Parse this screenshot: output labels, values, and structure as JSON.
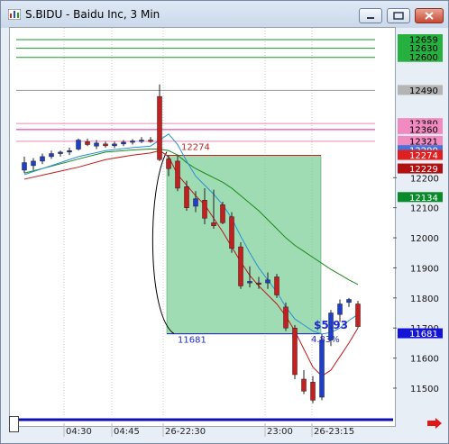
{
  "window": {
    "title": "S.BIDU - Baidu Inc, 3 Min",
    "colors": {
      "title_bg": "#d6e2f0",
      "close": "#c8503a"
    }
  },
  "controls": {
    "minimize_icon": "minimize-icon",
    "maximize_icon": "maximize-icon",
    "close_icon": "close-icon"
  },
  "chart_data": {
    "type": "candlestick",
    "title": "",
    "ylim": [
      11420,
      12710
    ],
    "y_ticks": [
      {
        "value": 11500,
        "label": "11500"
      },
      {
        "value": 11600,
        "label": "11600"
      },
      {
        "value": 11700,
        "label": "11700"
      },
      {
        "value": 11800,
        "label": "11800"
      },
      {
        "value": 11900,
        "label": "11900"
      },
      {
        "value": 12000,
        "label": "12000"
      },
      {
        "value": 12100,
        "label": "12100"
      },
      {
        "value": 12200,
        "label": "12200"
      }
    ],
    "x_labels": [
      "04:30",
      "04:45",
      "26-22:30",
      "23:00",
      "26-23:15"
    ],
    "price_tags": [
      {
        "value": 12659,
        "label": "12659",
        "bg": "#26b040",
        "fg": "#000000"
      },
      {
        "value": 12630,
        "label": "12630",
        "bg": "#26b040",
        "fg": "#000000"
      },
      {
        "value": 12600,
        "label": "12600",
        "bg": "#26b040",
        "fg": "#000000"
      },
      {
        "value": 12490,
        "label": "12490",
        "bg": "#b4b4b4",
        "fg": "#000000"
      },
      {
        "value": 12380,
        "label": "12380",
        "bg": "#f08ac0",
        "fg": "#000000"
      },
      {
        "value": 12360,
        "label": "12360",
        "bg": "#f08ac0",
        "fg": "#000000"
      },
      {
        "value": 12321,
        "label": "12321",
        "bg": "#f08ac0",
        "fg": "#000000"
      },
      {
        "value": 12290,
        "label": "12290",
        "bg": "#4a72d8",
        "fg": "#ffffff"
      },
      {
        "value": 12274,
        "label": "12274",
        "bg": "#e02020",
        "fg": "#ffffff"
      },
      {
        "value": 12229,
        "label": "12229",
        "bg": "#b01010",
        "fg": "#ffffff"
      },
      {
        "value": 12134,
        "label": "12134",
        "bg": "#0a8a2a",
        "fg": "#ffffff"
      },
      {
        "value": 11681,
        "label": "11681",
        "bg": "#1414d8",
        "fg": "#ffffff"
      }
    ],
    "levels": [
      {
        "value": 12659,
        "color": "#1a9a2a"
      },
      {
        "value": 12630,
        "color": "#1a9a2a"
      },
      {
        "value": 12600,
        "color": "#1a9a2a"
      },
      {
        "value": 12490,
        "color": "#9a9a9a"
      },
      {
        "value": 12380,
        "color": "#e98ab8"
      },
      {
        "value": 12360,
        "color": "#e020a0"
      },
      {
        "value": 12321,
        "color": "#e98ab8"
      }
    ],
    "candles": [
      {
        "o": 12250,
        "h": 12270,
        "l": 12215,
        "c": 12225,
        "bull": true
      },
      {
        "o": 12240,
        "h": 12265,
        "l": 12225,
        "c": 12255,
        "bull": true
      },
      {
        "o": 12255,
        "h": 12280,
        "l": 12245,
        "c": 12270,
        "bull": true
      },
      {
        "o": 12270,
        "h": 12290,
        "l": 12262,
        "c": 12280,
        "bull": true
      },
      {
        "o": 12280,
        "h": 12290,
        "l": 12270,
        "c": 12285,
        "bull": true
      },
      {
        "o": 12285,
        "h": 12300,
        "l": 12275,
        "c": 12290,
        "bull": true
      },
      {
        "o": 12295,
        "h": 12330,
        "l": 12290,
        "c": 12325,
        "bull": true
      },
      {
        "o": 12320,
        "h": 12330,
        "l": 12305,
        "c": 12310,
        "bull": false
      },
      {
        "o": 12305,
        "h": 12325,
        "l": 12295,
        "c": 12315,
        "bull": true
      },
      {
        "o": 12312,
        "h": 12320,
        "l": 12300,
        "c": 12306,
        "bull": false
      },
      {
        "o": 12306,
        "h": 12320,
        "l": 12298,
        "c": 12312,
        "bull": true
      },
      {
        "o": 12312,
        "h": 12325,
        "l": 12305,
        "c": 12318,
        "bull": true
      },
      {
        "o": 12318,
        "h": 12328,
        "l": 12310,
        "c": 12322,
        "bull": true
      },
      {
        "o": 12322,
        "h": 12335,
        "l": 12315,
        "c": 12325,
        "bull": true
      },
      {
        "o": 12325,
        "h": 12335,
        "l": 12316,
        "c": 12320,
        "bull": false
      },
      {
        "o": 12470,
        "h": 12510,
        "l": 12255,
        "c": 12260,
        "bull": false
      },
      {
        "o": 12262,
        "h": 12272,
        "l": 12205,
        "c": 12230,
        "bull": false
      },
      {
        "o": 12255,
        "h": 12275,
        "l": 12155,
        "c": 12165,
        "bull": false
      },
      {
        "o": 12170,
        "h": 12190,
        "l": 12090,
        "c": 12100,
        "bull": false
      },
      {
        "o": 12105,
        "h": 12155,
        "l": 12085,
        "c": 12130,
        "bull": true
      },
      {
        "o": 12125,
        "h": 12165,
        "l": 12045,
        "c": 12065,
        "bull": false
      },
      {
        "o": 12050,
        "h": 12160,
        "l": 12030,
        "c": 12040,
        "bull": false
      },
      {
        "o": 12110,
        "h": 12120,
        "l": 12045,
        "c": 12050,
        "bull": false
      },
      {
        "o": 12070,
        "h": 12085,
        "l": 11950,
        "c": 11965,
        "bull": false
      },
      {
        "o": 11970,
        "h": 11985,
        "l": 11830,
        "c": 11840,
        "bull": false
      },
      {
        "o": 11850,
        "h": 11905,
        "l": 11835,
        "c": 11855,
        "bull": true
      },
      {
        "o": 11850,
        "h": 11870,
        "l": 11830,
        "c": 11845,
        "bull": false
      },
      {
        "o": 11850,
        "h": 11885,
        "l": 11830,
        "c": 11860,
        "bull": true
      },
      {
        "o": 11870,
        "h": 11880,
        "l": 11800,
        "c": 11810,
        "bull": false
      },
      {
        "o": 11770,
        "h": 11785,
        "l": 11690,
        "c": 11700,
        "bull": false
      },
      {
        "o": 11700,
        "h": 11710,
        "l": 11530,
        "c": 11545,
        "bull": false
      },
      {
        "o": 11530,
        "h": 11560,
        "l": 11480,
        "c": 11490,
        "bull": false
      },
      {
        "o": 11520,
        "h": 11540,
        "l": 11450,
        "c": 11460,
        "bull": false
      },
      {
        "o": 11470,
        "h": 11680,
        "l": 11460,
        "c": 11660,
        "bull": true
      },
      {
        "o": 11660,
        "h": 11760,
        "l": 11640,
        "c": 11750,
        "bull": true
      },
      {
        "o": 11745,
        "h": 11795,
        "l": 11720,
        "c": 11780,
        "bull": true
      },
      {
        "o": 11785,
        "h": 11800,
        "l": 11770,
        "c": 11795,
        "bull": true
      },
      {
        "o": 11780,
        "h": 11790,
        "l": 11700,
        "c": 11705,
        "bull": false
      }
    ],
    "ma_fast": [
      [
        0,
        12210
      ],
      [
        3,
        12240
      ],
      [
        6,
        12270
      ],
      [
        9,
        12290
      ],
      [
        12,
        12300
      ],
      [
        14,
        12305
      ],
      [
        15,
        12325
      ],
      [
        16,
        12345
      ],
      [
        17,
        12310
      ],
      [
        18,
        12255
      ],
      [
        19,
        12205
      ],
      [
        20,
        12175
      ],
      [
        21,
        12145
      ],
      [
        22,
        12110
      ],
      [
        23,
        12065
      ],
      [
        24,
        12005
      ],
      [
        25,
        11950
      ],
      [
        26,
        11900
      ],
      [
        27,
        11860
      ],
      [
        28,
        11820
      ],
      [
        29,
        11770
      ],
      [
        30,
        11730
      ],
      [
        31,
        11710
      ],
      [
        32,
        11690
      ],
      [
        33,
        11680
      ],
      [
        34,
        11685
      ],
      [
        35,
        11700
      ],
      [
        36,
        11725
      ],
      [
        37,
        11745
      ]
    ],
    "ma_mid": [
      [
        0,
        12215
      ],
      [
        3,
        12238
      ],
      [
        6,
        12262
      ],
      [
        9,
        12285
      ],
      [
        12,
        12292
      ],
      [
        14,
        12295
      ],
      [
        15,
        12295
      ],
      [
        16,
        12290
      ],
      [
        17,
        12275
      ],
      [
        18,
        12250
      ],
      [
        19,
        12230
      ],
      [
        20,
        12215
      ],
      [
        21,
        12200
      ],
      [
        22,
        12185
      ],
      [
        23,
        12165
      ],
      [
        24,
        12140
      ],
      [
        25,
        12115
      ],
      [
        26,
        12090
      ],
      [
        27,
        12060
      ],
      [
        28,
        12030
      ],
      [
        29,
        12000
      ],
      [
        30,
        11975
      ],
      [
        31,
        11955
      ],
      [
        32,
        11935
      ],
      [
        33,
        11915
      ],
      [
        34,
        11895
      ],
      [
        35,
        11878
      ],
      [
        36,
        11860
      ],
      [
        37,
        11845
      ]
    ],
    "ma_slow": [
      [
        0,
        12195
      ],
      [
        3,
        12215
      ],
      [
        6,
        12235
      ],
      [
        9,
        12260
      ],
      [
        12,
        12275
      ],
      [
        14,
        12282
      ],
      [
        15,
        12290
      ],
      [
        16,
        12270
      ],
      [
        17,
        12210
      ],
      [
        18,
        12175
      ],
      [
        19,
        12140
      ],
      [
        20,
        12110
      ],
      [
        21,
        12065
      ],
      [
        22,
        12020
      ],
      [
        23,
        11970
      ],
      [
        24,
        11920
      ],
      [
        25,
        11875
      ],
      [
        26,
        11840
      ],
      [
        27,
        11810
      ],
      [
        28,
        11780
      ],
      [
        29,
        11740
      ],
      [
        30,
        11690
      ],
      [
        31,
        11630
      ],
      [
        32,
        11570
      ],
      [
        33,
        11540
      ],
      [
        34,
        11560
      ],
      [
        35,
        11605
      ],
      [
        36,
        11650
      ],
      [
        37,
        11700
      ]
    ],
    "zone": {
      "from_value": 12274,
      "to_value": 11681,
      "from_label": "12274",
      "to_label": "11681",
      "start_index": 16,
      "end_index": 33
    },
    "annotations": {
      "profit": "$5.93",
      "percent": "4.83%"
    }
  }
}
